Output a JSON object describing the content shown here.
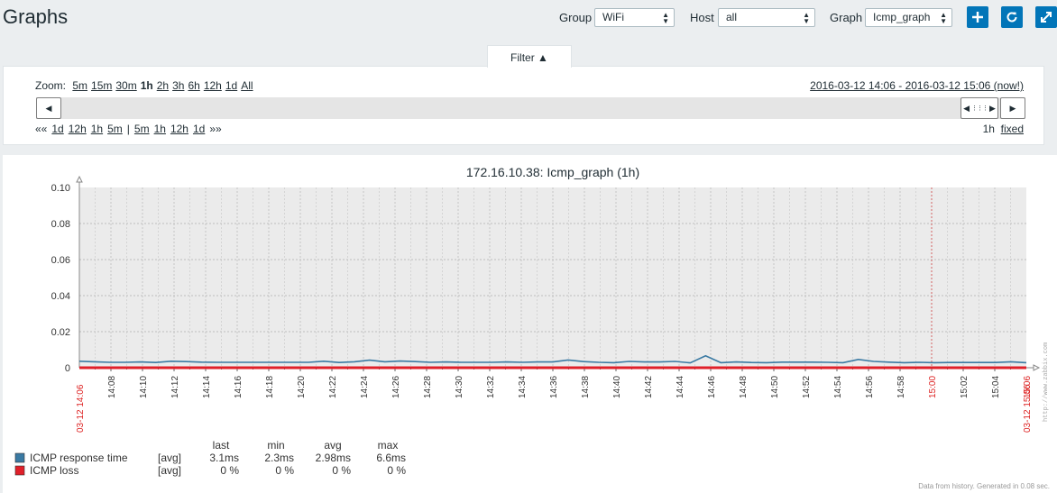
{
  "header": {
    "title": "Graphs",
    "group_label": "Group",
    "group_value": "WiFi",
    "host_label": "Host",
    "host_value": "all",
    "graph_label": "Graph",
    "graph_value": "Icmp_graph"
  },
  "filter": {
    "tab_label": "Filter ▲",
    "zoom_label": "Zoom:",
    "zoom_options": [
      "5m",
      "15m",
      "30m",
      "1h",
      "2h",
      "3h",
      "6h",
      "12h",
      "1d",
      "All"
    ],
    "zoom_selected": "1h",
    "time_range": "2016-03-12 14:06 - 2016-03-12 15:06 (now!)",
    "nav_back": [
      "««",
      "1d",
      "12h",
      "1h",
      "5m"
    ],
    "nav_sep": "|",
    "nav_forward": [
      "5m",
      "1h",
      "12h",
      "1d",
      "»»"
    ],
    "period_value": "1h",
    "period_mode": "fixed"
  },
  "chart_data": {
    "type": "line",
    "title": "172.16.10.38: Icmp_graph  (1h)",
    "ylim": [
      0,
      0.1
    ],
    "y_ticks": [
      "0.10",
      "0.08",
      "0.06",
      "0.04",
      "0.02",
      "0"
    ],
    "x_ticks": [
      "14:08",
      "14:10",
      "14:12",
      "14:14",
      "14:16",
      "14:18",
      "14:20",
      "14:22",
      "14:24",
      "14:26",
      "14:28",
      "14:30",
      "14:32",
      "14:34",
      "14:36",
      "14:38",
      "14:40",
      "14:42",
      "14:44",
      "14:46",
      "14:48",
      "14:50",
      "14:52",
      "14:54",
      "14:56",
      "14:58",
      "15:00",
      "15:02",
      "15:04",
      "15:06"
    ],
    "x_start_label": "03-12 14:06",
    "x_end_label": "03-12 15:06",
    "grid": true,
    "series": [
      {
        "name": "ICMP response time",
        "color": "#3a7aa3",
        "values": [
          0.0036,
          0.0033,
          0.003,
          0.003,
          0.0032,
          0.0029,
          0.0036,
          0.0034,
          0.0031,
          0.003,
          0.003,
          0.003,
          0.003,
          0.003,
          0.003,
          0.003,
          0.0036,
          0.0029,
          0.0033,
          0.0042,
          0.0033,
          0.0037,
          0.0034,
          0.003,
          0.0032,
          0.003,
          0.003,
          0.003,
          0.0032,
          0.003,
          0.0032,
          0.0032,
          0.0043,
          0.0034,
          0.003,
          0.0028,
          0.0035,
          0.0032,
          0.0032,
          0.0035,
          0.0027,
          0.0066,
          0.0028,
          0.0032,
          0.0029,
          0.0028,
          0.0031,
          0.0031,
          0.0031,
          0.003,
          0.0028,
          0.0046,
          0.0035,
          0.0031,
          0.0028,
          0.003,
          0.0028,
          0.0029,
          0.0029,
          0.0029,
          0.0029,
          0.0033,
          0.0028
        ]
      },
      {
        "name": "ICMP loss",
        "color": "#e0202a",
        "values": [
          0,
          0
        ]
      }
    ],
    "legend": {
      "headers": [
        "last",
        "min",
        "avg",
        "max"
      ],
      "rows": [
        {
          "name": "ICMP response time",
          "func": "[avg]",
          "last": "3.1ms",
          "min": "2.3ms",
          "avg": "2.98ms",
          "max": "6.6ms",
          "color": "#3a7aa3"
        },
        {
          "name": "ICMP loss",
          "func": "[avg]",
          "last": "0 %",
          "min": "0 %",
          "avg": "0 %",
          "max": "0 %",
          "color": "#e0202a"
        }
      ]
    },
    "watermark": "http://www.zabbix.com",
    "generated": "Data from history. Generated in 0.08 sec."
  }
}
